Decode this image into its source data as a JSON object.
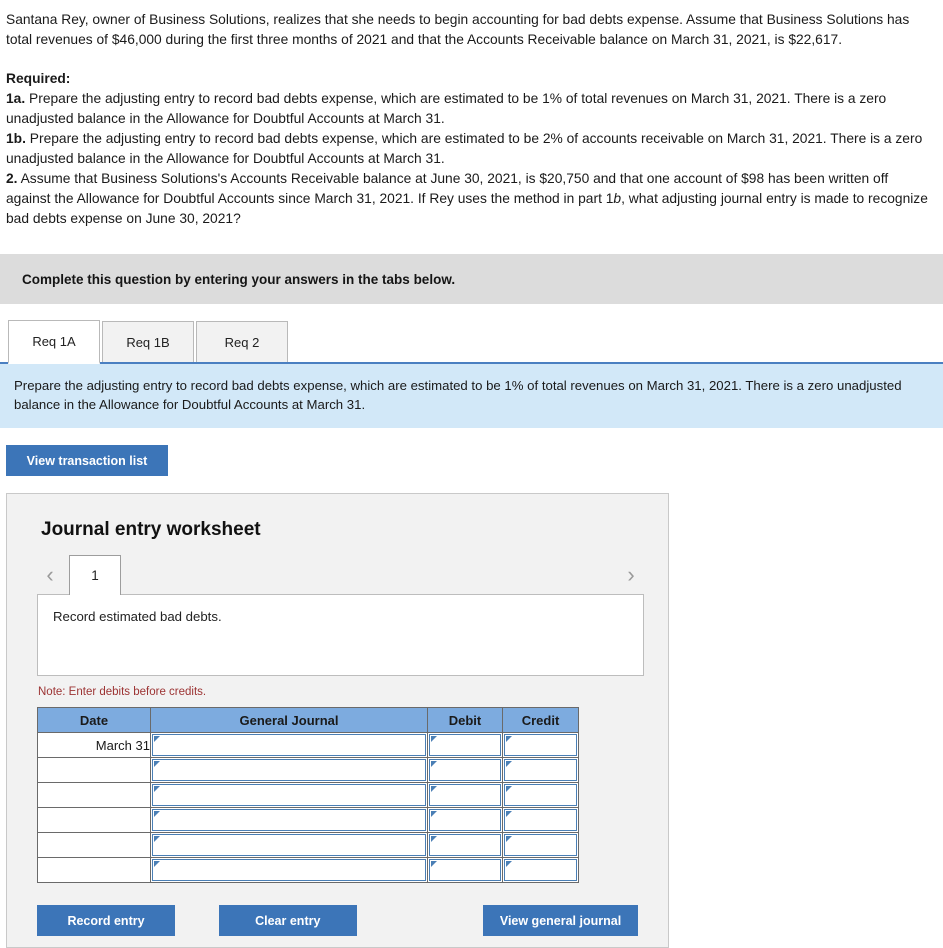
{
  "stem": {
    "paragraph": "Santana Rey, owner of Business Solutions, realizes that she needs to begin accounting for bad debts expense. Assume that Business Solutions has total revenues of $46,000 during the first three months of 2021 and that the Accounts Receivable balance on March 31, 2021, is $22,617."
  },
  "required": {
    "heading": "Required:",
    "items": [
      {
        "number": "1a.",
        "text_before": " Prepare the adjusting entry to record bad debts expense, which are estimated to be 1% of total revenues on March 31, 2021. There is a zero unadjusted balance in the Allowance for Doubtful Accounts at March 31.",
        "italic": "",
        "text_after": ""
      },
      {
        "number": "1b.",
        "text_before": " Prepare the adjusting entry to record bad debts expense, which are estimated to be 2% of accounts receivable on March 31, 2021. There is a zero unadjusted balance in the Allowance for Doubtful Accounts at March 31.",
        "italic": "",
        "text_after": ""
      },
      {
        "number": "2.",
        "text_before": " Assume that Business Solutions's Accounts Receivable balance at June 30, 2021, is $20,750 and that one account of $98 has been written off against the Allowance for Doubtful Accounts since March 31, 2021. If Rey uses the method in part 1",
        "italic": "b",
        "text_after": ", what adjusting journal entry is made to recognize bad debts expense on June 30, 2021?"
      }
    ]
  },
  "banner": {
    "complete_text": "Complete this question by entering your answers in the tabs below."
  },
  "tabs": [
    {
      "label": "Req 1A",
      "active": true
    },
    {
      "label": "Req 1B",
      "active": false
    },
    {
      "label": "Req 2",
      "active": false
    }
  ],
  "subinstruction": {
    "text": "Prepare the adjusting entry to record bad debts expense, which are estimated to be 1% of total revenues on March 31, 2021. There is a zero unadjusted balance in the Allowance for Doubtful Accounts at March 31."
  },
  "actions": {
    "view_transaction_list": "View transaction list",
    "record_entry": "Record entry",
    "clear_entry": "Clear entry",
    "view_general_journal": "View general journal"
  },
  "worksheet": {
    "title": "Journal entry worksheet",
    "pager": {
      "prev_icon": "chevron-left-icon",
      "next_icon": "chevron-right-icon",
      "pages": [
        "1"
      ],
      "active_page": "1"
    },
    "description": "Record estimated bad debts.",
    "note": "Note: Enter debits before credits.",
    "table": {
      "headers": [
        "Date",
        "General Journal",
        "Debit",
        "Credit"
      ],
      "rows": [
        {
          "date": "March 31",
          "general_journal": "",
          "debit": "",
          "credit": ""
        },
        {
          "date": "",
          "general_journal": "",
          "debit": "",
          "credit": ""
        },
        {
          "date": "",
          "general_journal": "",
          "debit": "",
          "credit": ""
        },
        {
          "date": "",
          "general_journal": "",
          "debit": "",
          "credit": ""
        },
        {
          "date": "",
          "general_journal": "",
          "debit": "",
          "credit": ""
        },
        {
          "date": "",
          "general_journal": "",
          "debit": "",
          "credit": ""
        }
      ]
    }
  },
  "colors": {
    "primary_button": "#3c75b8",
    "table_header": "#7dabdf",
    "info_banner": "#d2e8f8",
    "gray_banner": "#dcdcdc",
    "note_red": "#9c3333",
    "field_border": "#4a7fb5"
  }
}
